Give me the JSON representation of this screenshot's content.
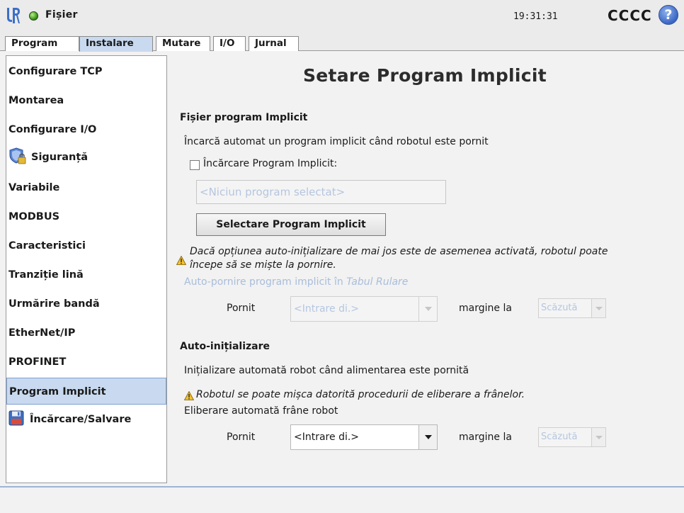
{
  "titlebar": {
    "file_label": "Fișier",
    "time": "19:31:31",
    "robot_name": "CCCC",
    "help_label": "?"
  },
  "tabs": [
    {
      "label": "Program"
    },
    {
      "label": "Instalare"
    },
    {
      "label": "Mutare"
    },
    {
      "label": "I/O"
    },
    {
      "label": "Jurnal"
    }
  ],
  "sidebar": {
    "items": [
      {
        "label": "Configurare TCP"
      },
      {
        "label": "Montarea"
      },
      {
        "label": "Configurare I/O"
      },
      {
        "label": "Siguranță",
        "icon": "safety-shield-lock-icon"
      },
      {
        "label": "Variabile"
      },
      {
        "label": "MODBUS"
      },
      {
        "label": "Caracteristici"
      },
      {
        "label": "Tranziție lină"
      },
      {
        "label": "Urmărire bandă"
      },
      {
        "label": "EtherNet/IP"
      },
      {
        "label": "PROFINET"
      },
      {
        "label": "Program Implicit"
      },
      {
        "label": "Încărcare/Salvare",
        "icon": "floppy-disk-icon"
      }
    ]
  },
  "main": {
    "title": "Setare Program Implicit",
    "default_program": {
      "heading": "Fișier program Implicit",
      "description": "Încarcă automat un program implicit când robotul este pornit",
      "checkbox_label": "Încărcare Program Implicit:",
      "program_placeholder": "<Niciun program selectat>",
      "select_button": "Selectare Program Implicit",
      "warning_line1": "Dacă opțiunea auto-inițializare de mai jos este de asemenea activată, robotul poate",
      "warning_line2": "începe să se miște la pornire.",
      "autostart_label": "Auto-pornire program implicit în",
      "autostart_tab": "Tabul Rulare",
      "on_label": "Pornit",
      "input_value": "<Intrare di.>",
      "edge_label": "margine la",
      "edge_value": "Scăzută"
    },
    "auto_init": {
      "heading": "Auto-inițializare",
      "description": "Inițializare automată robot când alimentarea este pornită",
      "warning": "Robotul se poate mișca datorită procedurii de eliberare a frânelor.",
      "brake_label": "Eliberare automată frâne robot",
      "on_label": "Pornit",
      "input_value": "<Intrare di.>",
      "edge_label": "margine la",
      "edge_value": "Scăzută"
    }
  },
  "colors": {
    "active_tab": "#c9daf0",
    "disabled_text": "#a8bddb",
    "accent": "#3a66c4"
  }
}
